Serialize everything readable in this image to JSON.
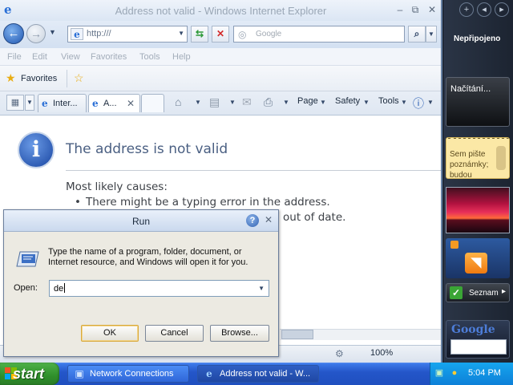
{
  "ie": {
    "title": "Address not valid - Windows Internet Explorer",
    "address": "http:///",
    "search_placeholder": "Google",
    "menu": [
      "File",
      "Edit",
      "View",
      "Favorites",
      "Tools",
      "Help"
    ],
    "favorites_label": "Favorites",
    "tabs": [
      {
        "label": "Inter..."
      },
      {
        "label": "A..."
      }
    ],
    "command_bar": {
      "page": "Page",
      "safety": "Safety",
      "tools": "Tools"
    },
    "status": {
      "zoom": "100%"
    }
  },
  "page": {
    "heading": "The address is not valid",
    "causes_title": "Most likely causes:",
    "causes": [
      "There might be a typing error in the address.",
      "out of date."
    ]
  },
  "run_dialog": {
    "title": "Run",
    "description": "Type the name of a program, folder, document, or Internet resource, and Windows will open it for you.",
    "open_label": "Open:",
    "input_value": "de",
    "ok_label": "OK",
    "cancel_label": "Cancel",
    "browse_label": "Browse..."
  },
  "sidebar": {
    "network_status": "Nepřipojeno",
    "loading_text": "Načítání...",
    "notes_text": "Sem pište poznámky; budou",
    "seznam_label": "Seznam",
    "google_logo": "Google"
  },
  "taskbar": {
    "start_label": "start",
    "items": [
      {
        "label": "Network Connections"
      },
      {
        "label": "Address not valid - W..."
      }
    ],
    "clock": "5:04 PM"
  },
  "colors": {
    "ie_accent": "#2a6fd6",
    "taskbar_blue": "#2456c9",
    "start_green": "#2f8f2b",
    "heading_text": "#4a5f82"
  }
}
